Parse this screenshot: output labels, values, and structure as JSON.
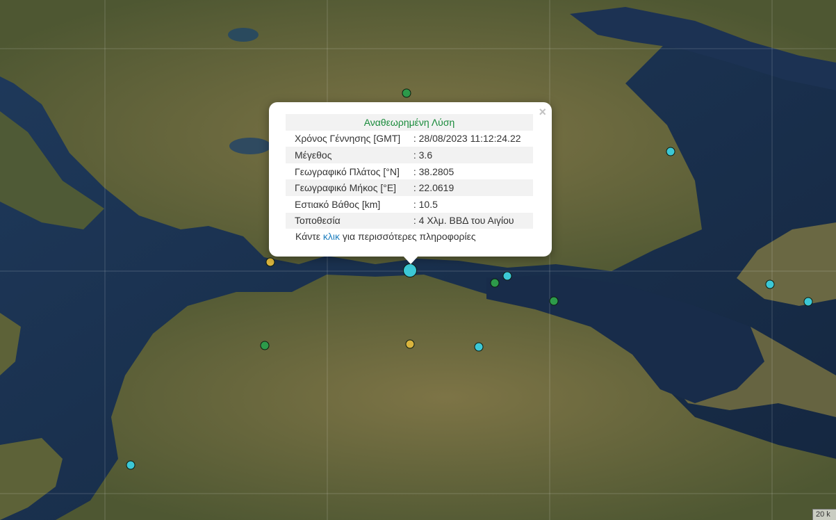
{
  "popup": {
    "title": "Αναθεωρημένη Λύση",
    "close_label": "×",
    "rows": [
      {
        "label": "Χρόνος Γέννησης [GMT]",
        "value": ": 28/08/2023 11:12:24.22"
      },
      {
        "label": "Μέγεθος",
        "value": ": 3.6"
      },
      {
        "label": "Γεωγραφικό Πλάτος [°N]",
        "value": ": 38.2805"
      },
      {
        "label": "Γεωγραφικό Μήκος [°E]",
        "value": ": 22.0619"
      },
      {
        "label": "Εστιακό Βάθος [km]",
        "value": ": 10.5"
      },
      {
        "label": "Τοποθεσία",
        "value": ": 4 Χλμ. ΒΒΔ του Αιγίου"
      }
    ],
    "more_prefix": "Κάντε ",
    "more_link": "κλικ",
    "more_suffix": " για περισσότερες πληροφορίες"
  },
  "scale": {
    "label": "20 k"
  },
  "colors": {
    "cyan": "#3cc8d6",
    "green": "#2d9a4a",
    "yellow": "#d9b43e",
    "sea_dark": "#1b2f4c",
    "land": "#6b6a3c"
  }
}
